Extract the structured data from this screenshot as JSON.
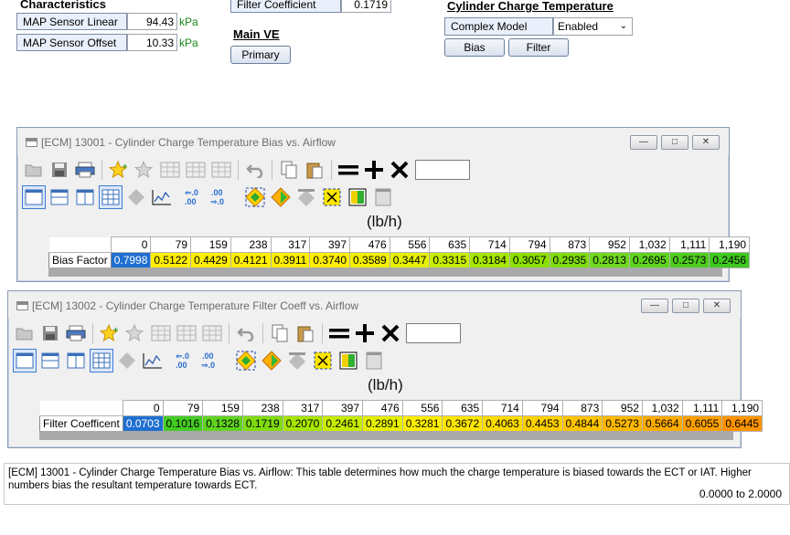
{
  "top": {
    "characteristics_title": "Characteristics",
    "params": [
      {
        "label": "MAP Sensor Linear",
        "value": "94.43",
        "unit": "kPa"
      },
      {
        "label": "MAP Sensor Offset",
        "value": "10.33",
        "unit": "kPa"
      }
    ],
    "filter_coeff_label": "Filter Coefficient",
    "filter_coeff_value": "0.1719",
    "main_ve_title": "Main VE",
    "primary_button": "Primary",
    "cct_title": "Cylinder Charge Temperature",
    "complex_model_label": "Complex Model",
    "complex_model_value": "Enabled",
    "bias_button": "Bias",
    "filter_button": "Filter"
  },
  "windows": [
    {
      "title": "[ECM] 13001 - Cylinder Charge Temperature Bias vs. Airflow",
      "axis_unit": "(lb/h)",
      "axis": [
        "0",
        "79",
        "159",
        "238",
        "317",
        "397",
        "476",
        "556",
        "635",
        "714",
        "794",
        "873",
        "952",
        "1,032",
        "1,111",
        "1,190"
      ],
      "row_label": "Bias Factor",
      "values": [
        "0.7998",
        "0.5122",
        "0.4429",
        "0.4121",
        "0.3911",
        "0.3740",
        "0.3589",
        "0.3447",
        "0.3315",
        "0.3184",
        "0.3057",
        "0.2935",
        "0.2813",
        "0.2695",
        "0.2573",
        "0.2456"
      ],
      "colors": [
        "#1f6fd1",
        "#ffee00",
        "#ffee00",
        "#ffee00",
        "#ffee00",
        "#ffee00",
        "#f2f000",
        "#e6f000",
        "#c8ec00",
        "#a7e600",
        "#8ee000",
        "#7fdc10",
        "#6fd820",
        "#5fd420",
        "#4fce20",
        "#3fc820"
      ]
    },
    {
      "title": "[ECM] 13002 - Cylinder Charge Temperature Filter Coeff vs. Airflow",
      "axis_unit": "(lb/h)",
      "axis": [
        "0",
        "79",
        "159",
        "238",
        "317",
        "397",
        "476",
        "556",
        "635",
        "714",
        "794",
        "873",
        "952",
        "1,032",
        "1,111",
        "1,190"
      ],
      "row_label": "Filter Coefficent",
      "values": [
        "0.0703",
        "0.1016",
        "0.1328",
        "0.1719",
        "0.2070",
        "0.2461",
        "0.2891",
        "0.3281",
        "0.3672",
        "0.4063",
        "0.4453",
        "0.4844",
        "0.5273",
        "0.5664",
        "0.6055",
        "0.6445"
      ],
      "colors": [
        "#1f6fd1",
        "#44cc22",
        "#5fd420",
        "#7fdc10",
        "#a7e600",
        "#c8ec00",
        "#e6f000",
        "#ffee00",
        "#ffe600",
        "#ffdc00",
        "#ffd000",
        "#ffc400",
        "#ffb800",
        "#ffac00",
        "#ffa000",
        "#ff9400"
      ]
    }
  ],
  "status": {
    "text": "[ECM] 13001 - Cylinder Charge Temperature Bias vs. Airflow: This table determines how much the charge temperature is biased towards the ECT or IAT. Higher numbers bias the resultant temperature towards ECT.",
    "range": "0.0000 to 2.0000"
  },
  "icons": [
    "open-icon",
    "save-icon",
    "print-icon",
    "add-favorite-icon",
    "remove-favorite-icon",
    "table-icon",
    "undo-icon",
    "copy-icon",
    "paste-icon",
    "equals-icon",
    "plus-icon",
    "multiply-icon",
    "layout-icon",
    "chart-icon",
    "decimal-icon",
    "color-icon"
  ]
}
